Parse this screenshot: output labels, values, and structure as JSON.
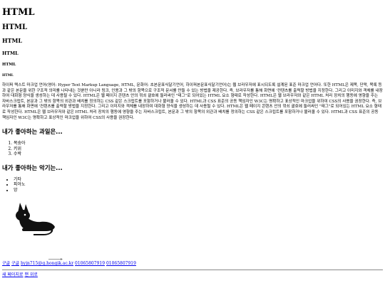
{
  "headings": {
    "h1": "HTML",
    "h2": "HTML",
    "h3": "HTML",
    "h4": "HTML",
    "h5": "HTML",
    "h6": "HTML"
  },
  "intro": "하이퍼 텍스트 마크업 언어(영어: Hyper Text Markup Language, HTML, 문화어: 초본문표식달기언어, 하이퍼본문표식달기언어)는 웹 브라우저에 표시되도록 설계된 표준 마크업 언어다. 또한 HTML은 제목, 단락, 목록 등과 같은 본문을 위한 구조적 의미를 나타내는 것뿐만 아니라 링크, 인용과 그 밖의 항목으로 구조적 문서를 만들 수 있는 방법을 제공한다. 즉, 브라우저를 통해 화면에 '컨텐츠를 출력할 방법을 지정한다. 그리고 이미지와 객체를 내장하여 대화형 양식을 생성하는 데 사용될 수 있다. HTML은 웹 페이지 콘텐츠 안의 꺾쇠 괄호에 둘러싸인 \"태그\"로 되어있는 HTML 요소 형태로 작성한다. HTML은 웹 브라우저와 같은 HTML 처리 장치의 행동에 영향을 주는 자바스크립트, 본문과 그 밖의 항목의 외관과 배치를 정의하는 CSS 같은 스크립트를 포함하거나 불러올 수 있다. HTML과 CSS 표준의 공동 책임자인 W3C는 명확하고 표상적인 마크업을 위하여 CSS의 사용을 권장한다. 즉, 브라우저를 통해 화면에 '컨텐츠를 출력할 방법을 지정한다. 그리고 이미지와 객체를 내장하여 대화형 양식을 생성하는 데 사용될 수 있다. HTML은 웹 페이지 콘텐츠 안의 꺾쇠 괄호에 둘러싸인 \"태그\"로 되어있는 HTML 요소 형태로 작성한다. HTML은 웹 브라우저와 같은 HTML 처리 장치의 행동에 영향을 주는 자바스크립트, 본문과 그 밖의 항목의 외관과 배치를 정의하는 CSS 같은 스크립트를 포함하거나 불러올 수 있다. HTML과 CSS 표준의 공동 책임자인 W3C는 명확하고 표상적인 마크업을 위하여 CSS의 사용을 권장한다.",
  "fruits": {
    "title": "내가 좋아하는 과일은...",
    "items": [
      "복숭아",
      "키위",
      "수박"
    ]
  },
  "instruments": {
    "title": "내가 좋아하는 악기는...",
    "items": [
      "기타",
      "피아노",
      "앙"
    ]
  },
  "image": {
    "icon": "cat-silhouette-icon"
  },
  "footer": {
    "contact1": "구글",
    "contact2": "구글",
    "email": "hyjn715@g.hongik.ac.kr",
    "phone1": "01065807919",
    "phone2": "01065807919",
    "new_page": "새 페이지로",
    "top": "맨 위로"
  }
}
